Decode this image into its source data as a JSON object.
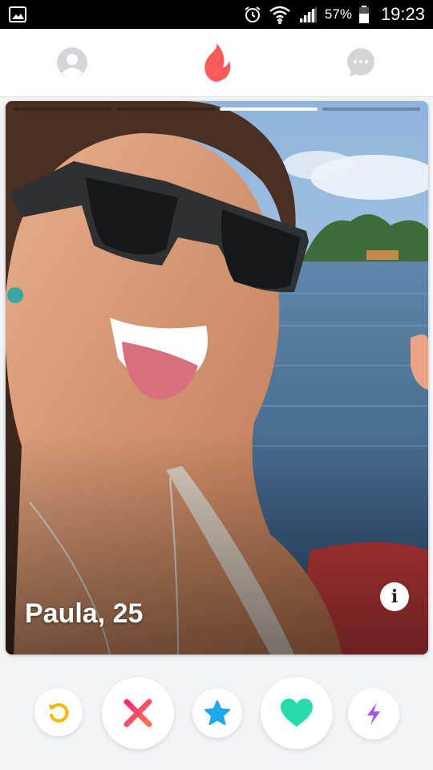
{
  "status_bar": {
    "battery_percent": "57%",
    "time": "19:23",
    "icons": [
      "image-icon",
      "alarm-icon",
      "wifi-icon",
      "signal-icon",
      "battery-icon"
    ]
  },
  "nav": {
    "icons": [
      "profile-icon",
      "flame-icon",
      "chat-icon"
    ],
    "colors": {
      "inactive": "#d3d5d9",
      "flame": "#fb5a5a"
    }
  },
  "card": {
    "name_age": "Paula, 25",
    "photo_count": 4,
    "active_photo_index": 2,
    "info_label": "i"
  },
  "actions": {
    "buttons": [
      {
        "icon": "rewind-icon",
        "color": "#f5b800"
      },
      {
        "icon": "nope-icon",
        "color": "#fd4d6f"
      },
      {
        "icon": "super-like-icon",
        "color": "#1ea8f2"
      },
      {
        "icon": "like-icon",
        "color": "#27dbad"
      },
      {
        "icon": "boost-icon",
        "color": "#a84ef5"
      }
    ]
  }
}
